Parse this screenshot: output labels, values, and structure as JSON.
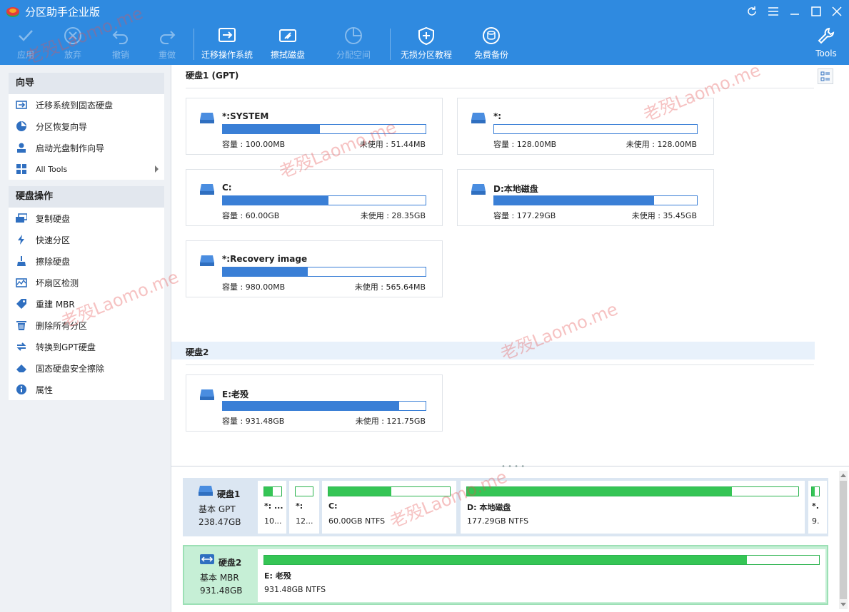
{
  "app": {
    "title": "分区助手企业版"
  },
  "toolbar": {
    "apply": "应用",
    "discard": "放弃",
    "undo": "撤销",
    "redo": "重做",
    "migrate_os": "迁移操作系统",
    "wipe_disk": "擦拭磁盘",
    "allocate_space": "分配空间",
    "lossless_tutorial": "无损分区教程",
    "free_backup": "免费备份",
    "tools": "Tools"
  },
  "sidebar": {
    "wizard_header": "向导",
    "wizard_items": [
      {
        "label": "迁移系统到固态硬盘",
        "icon": "migrate-ssd-icon"
      },
      {
        "label": "分区恢复向导",
        "icon": "partition-recovery-icon"
      },
      {
        "label": "启动光盘制作向导",
        "icon": "bootable-media-icon"
      },
      {
        "label": "All Tools",
        "icon": "all-tools-icon"
      }
    ],
    "disk_ops_header": "硬盘操作",
    "disk_ops_items": [
      {
        "label": "复制硬盘",
        "icon": "copy-disk-icon"
      },
      {
        "label": "快速分区",
        "icon": "quick-partition-icon"
      },
      {
        "label": "擦除硬盘",
        "icon": "wipe-disk-icon"
      },
      {
        "label": "坏扇区检测",
        "icon": "bad-sector-icon"
      },
      {
        "label": "重建 MBR",
        "icon": "rebuild-mbr-icon"
      },
      {
        "label": "删除所有分区",
        "icon": "delete-all-icon"
      },
      {
        "label": "转换到GPT硬盘",
        "icon": "convert-gpt-icon"
      },
      {
        "label": "固态硬盘安全擦除",
        "icon": "ssd-erase-icon"
      },
      {
        "label": "属性",
        "icon": "properties-icon"
      }
    ]
  },
  "disks": [
    {
      "title": "硬盘1 (GPT)",
      "partitions": [
        {
          "name": "*:SYSTEM",
          "capacity": "容量 : 100.00MB",
          "free": "未使用 : 51.44MB",
          "used_fraction": 0.48
        },
        {
          "name": "*:",
          "capacity": "容量 : 128.00MB",
          "free": "未使用 : 128.00MB",
          "used_fraction": 0.0
        },
        {
          "name": "C:",
          "capacity": "容量 : 60.00GB",
          "free": "未使用 : 28.35GB",
          "used_fraction": 0.52
        },
        {
          "name": "D:本地磁盘",
          "capacity": "容量 : 177.29GB",
          "free": "未使用 : 35.45GB",
          "used_fraction": 0.79
        },
        {
          "name": "*:Recovery image",
          "capacity": "容量 : 980.00MB",
          "free": "未使用 : 565.64MB",
          "used_fraction": 0.42
        }
      ]
    },
    {
      "title": "硬盘2",
      "partitions": [
        {
          "name": "E:老殁",
          "capacity": "容量 : 931.48GB",
          "free": "未使用 : 121.75GB",
          "used_fraction": 0.87
        }
      ]
    }
  ],
  "diskmap": [
    {
      "name": "硬盘1",
      "type": "基本 GPT",
      "size": "238.47GB",
      "segments": [
        {
          "name": "*: ...",
          "info": "10...",
          "used_fraction": 0.48
        },
        {
          "name": "*:",
          "info": "12...",
          "used_fraction": 0.0
        },
        {
          "name": "C:",
          "info": "60.00GB NTFS",
          "used_fraction": 0.52
        },
        {
          "name": "D: 本地磁盘",
          "info": "177.29GB NTFS",
          "used_fraction": 0.8
        },
        {
          "name": "*.",
          "info": "9.",
          "used_fraction": 0.42
        }
      ]
    },
    {
      "name": "硬盘2",
      "type": "基本 MBR",
      "size": "931.48GB",
      "segments": [
        {
          "name": "E: 老殁",
          "info": "931.48GB NTFS",
          "used_fraction": 0.87
        }
      ]
    }
  ],
  "watermark": "老殁Laomo.me",
  "colors": {
    "accent": "#2f8ae0",
    "partition_bar": "#3a7fd6",
    "map_bar": "#35c555"
  }
}
